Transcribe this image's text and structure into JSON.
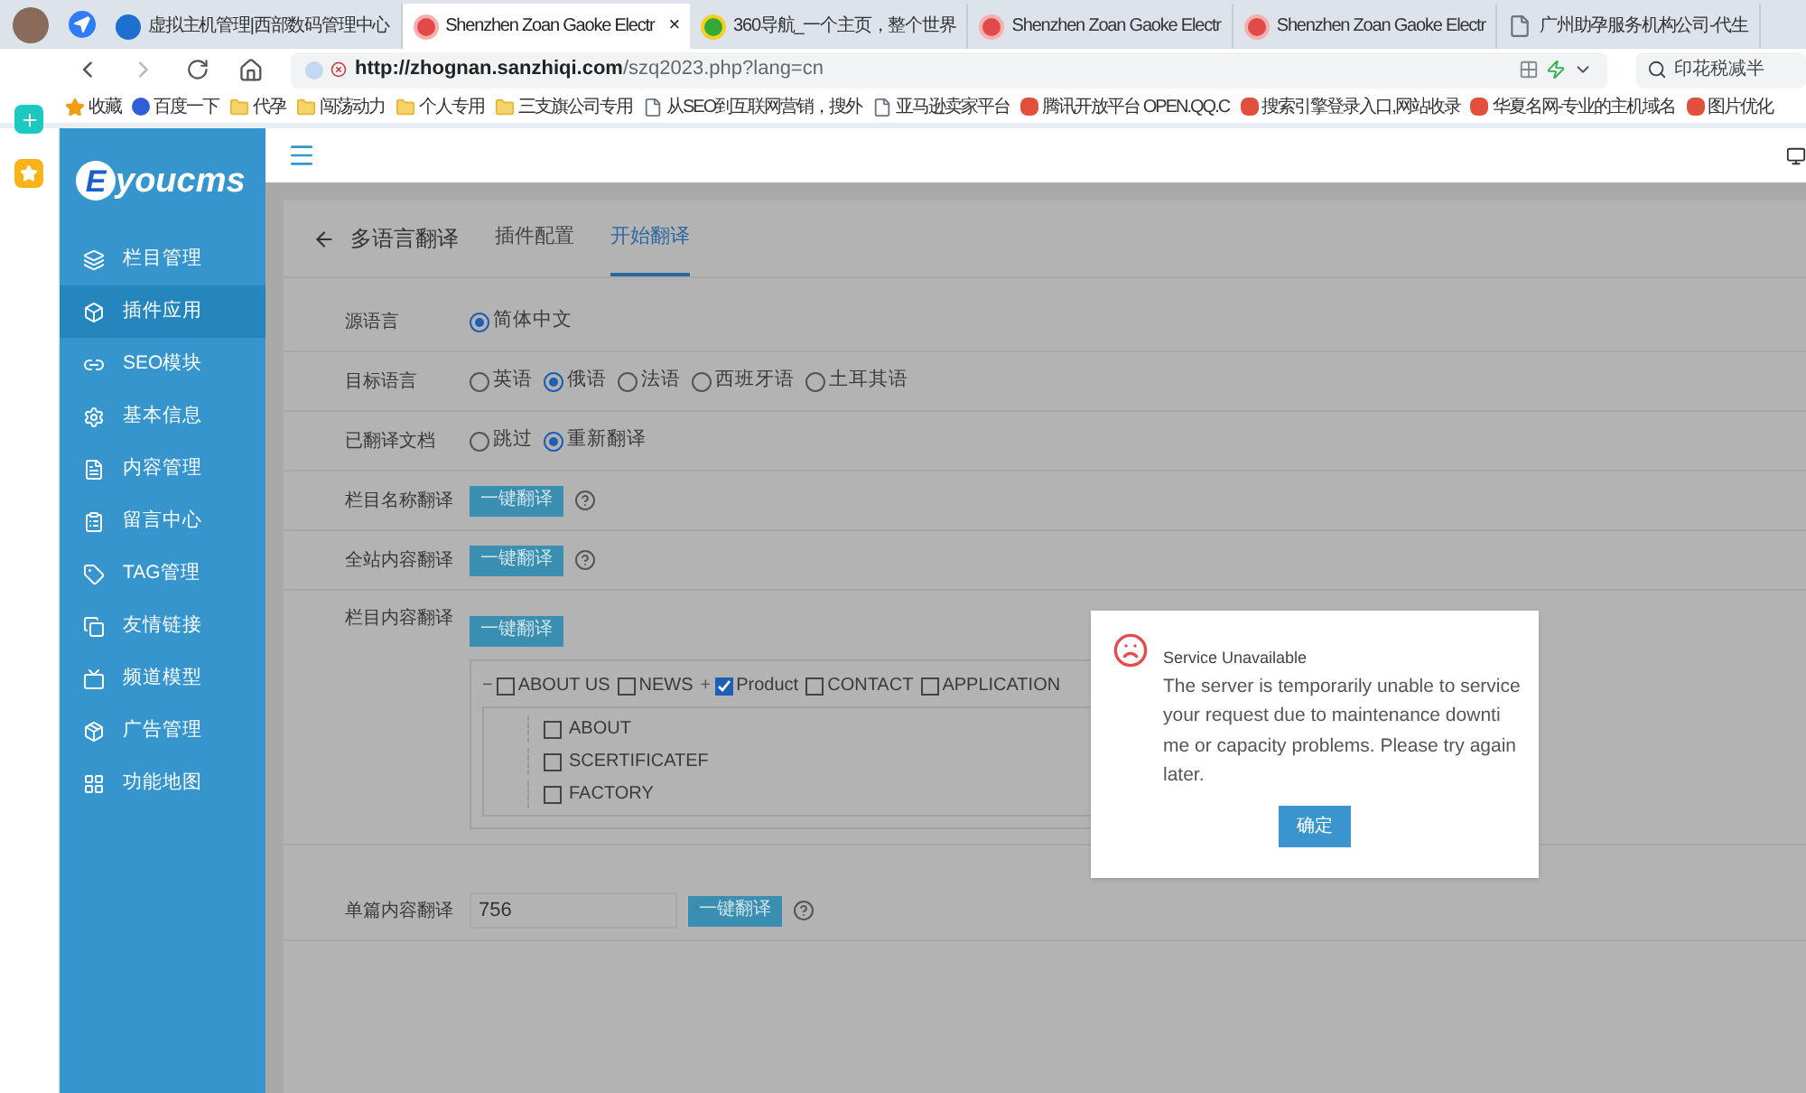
{
  "browser": {
    "tabs": [
      {
        "title": "虚拟主机管理|西部数码管理中心",
        "selected": false,
        "kind": "wave"
      },
      {
        "title": "Shenzhen Zoan Gaoke Electr",
        "selected": true,
        "kind": "red"
      },
      {
        "title": "360导航_一个主页，整个世界",
        "selected": false,
        "kind": "green"
      },
      {
        "title": "Shenzhen Zoan Gaoke Electr",
        "selected": false,
        "kind": "red"
      },
      {
        "title": "Shenzhen Zoan Gaoke Electr",
        "selected": false,
        "kind": "red"
      },
      {
        "title": "广州助孕服务机构公司-代生",
        "selected": false,
        "kind": "page"
      }
    ],
    "close": "×",
    "address_host": "http://zhognan.sanzhiqi.com",
    "address_path": "/szq2023.php?lang=cn",
    "search": "印花税减半",
    "bookmarks": [
      {
        "label": "收藏",
        "kind": "star"
      },
      {
        "label": "百度一下",
        "kind": "paw"
      },
      {
        "label": "代孕",
        "kind": "folder"
      },
      {
        "label": "闯荡动力",
        "kind": "folder"
      },
      {
        "label": "个人专用",
        "kind": "folder"
      },
      {
        "label": "三支旗公司专用",
        "kind": "folder"
      },
      {
        "label": "从SEO到互联网营销，搜外",
        "kind": "page"
      },
      {
        "label": "亚马逊卖家平台",
        "kind": "page"
      },
      {
        "label": "腾讯开放平台 OPEN.QQ.C",
        "kind": "site"
      },
      {
        "label": "搜索引擎登录入口,网站收录",
        "kind": "site"
      },
      {
        "label": "华夏名网-专业的主机域名",
        "kind": "site"
      },
      {
        "label": "图片优化",
        "kind": "site"
      }
    ]
  },
  "sidebar": {
    "logo_letter": "E",
    "logo_text": "youcms",
    "items": [
      {
        "label": "栏目管理",
        "kind": "layers",
        "selected": false
      },
      {
        "label": "插件应用",
        "kind": "box",
        "selected": true
      },
      {
        "label": "SEO模块",
        "kind": "link",
        "selected": false
      },
      {
        "label": "基本信息",
        "kind": "gear",
        "selected": false
      },
      {
        "label": "内容管理",
        "kind": "doc",
        "selected": false
      },
      {
        "label": "留言中心",
        "kind": "clip",
        "selected": false
      },
      {
        "label": "TAG管理",
        "kind": "tag",
        "selected": false
      },
      {
        "label": "友情链接",
        "kind": "copy",
        "selected": false
      },
      {
        "label": "频道模型",
        "kind": "tv",
        "selected": false
      },
      {
        "label": "广告管理",
        "kind": "ad",
        "selected": false
      },
      {
        "label": "功能地图",
        "kind": "grid",
        "selected": false
      }
    ]
  },
  "page": {
    "back_title": "多语言翻译",
    "tabs": [
      {
        "label": "插件配置",
        "selected": false
      },
      {
        "label": "开始翻译",
        "selected": true
      }
    ],
    "rows": [
      {
        "kind": "radio",
        "label": "源语言",
        "options": [
          {
            "label": "简体中文",
            "selected": true
          }
        ]
      },
      {
        "kind": "radio",
        "label": "目标语言",
        "options": [
          {
            "label": "英语",
            "selected": false
          },
          {
            "label": "俄语",
            "selected": true
          },
          {
            "label": "法语",
            "selected": false
          },
          {
            "label": "西班牙语",
            "selected": false
          },
          {
            "label": "土耳其语",
            "selected": false
          }
        ]
      },
      {
        "kind": "radio",
        "label": "已翻译文档",
        "options": [
          {
            "label": "跳过",
            "selected": false
          },
          {
            "label": "重新翻译",
            "selected": true
          }
        ]
      },
      {
        "kind": "button",
        "label": "栏目名称翻译",
        "button": "一键翻译",
        "help": true
      },
      {
        "kind": "button",
        "label": "全站内容翻译",
        "button": "一键翻译",
        "help": true
      },
      {
        "kind": "tree",
        "label": "栏目内容翻译",
        "button": "一键翻译",
        "top": [
          {
            "toggle": "−",
            "label": "ABOUT US",
            "checked": false
          },
          {
            "label": "NEWS",
            "checked": false
          },
          {
            "toggle": "+",
            "label": "Product",
            "checked": true
          },
          {
            "label": "CONTACT",
            "checked": false
          },
          {
            "label": "APPLICATION",
            "checked": false
          }
        ],
        "children": [
          {
            "label": "ABOUT",
            "checked": false
          },
          {
            "label": "SCERTIFICATEF",
            "checked": false
          },
          {
            "label": "FACTORY",
            "checked": false
          }
        ]
      },
      {
        "kind": "input",
        "label": "单篇内容翻译",
        "value": "756",
        "button": "一键翻译",
        "help": true
      }
    ]
  },
  "dialog": {
    "title": "Service Unavailable",
    "message": "The server is temporarily unable to service your request due to maintenance downti me or capacity problems. Please try again later.",
    "button": "确定"
  }
}
